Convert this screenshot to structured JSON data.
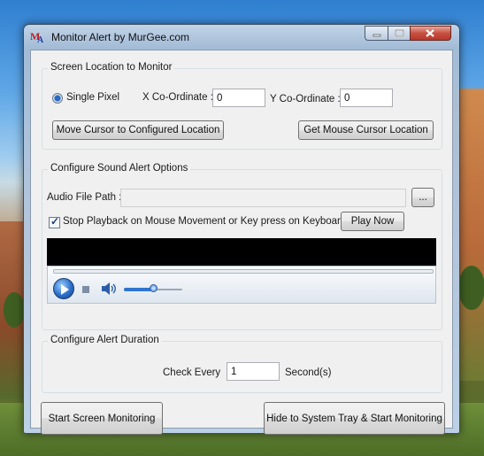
{
  "window": {
    "title": "Monitor Alert by MurGee.com",
    "icon_letters": [
      "M",
      "A"
    ]
  },
  "screen_location": {
    "title": "Screen Location to Monitor",
    "mode_label": "Single Pixel",
    "x_label": "X Co-Ordinate :",
    "x_value": "0",
    "y_label": "Y Co-Ordinate :",
    "y_value": "0",
    "move_button": "Move Cursor to Configured Location",
    "get_button": "Get Mouse Cursor Location"
  },
  "sound": {
    "title": "Configure Sound Alert Options",
    "audio_label": "Audio File Path :",
    "audio_value": "",
    "browse_button": "...",
    "stop_checkbox_label": "Stop Playback on Mouse Movement or Key press on Keyboard",
    "stop_checkbox_checked": true,
    "play_button": "Play Now",
    "player": {
      "icons": [
        "play-icon",
        "stop-icon",
        "speaker-icon"
      ],
      "volume_level": 0.5
    }
  },
  "duration": {
    "title": "Configure Alert Duration",
    "check_label": "Check Every",
    "check_value": "1",
    "unit_label": "Second(s)"
  },
  "actions": {
    "start_button": "Start Screen Monitoring",
    "tray_button": "Hide to System Tray & Start Monitoring"
  },
  "colors": {
    "accent": "#2c6fc9",
    "close_button": "#c75040"
  }
}
